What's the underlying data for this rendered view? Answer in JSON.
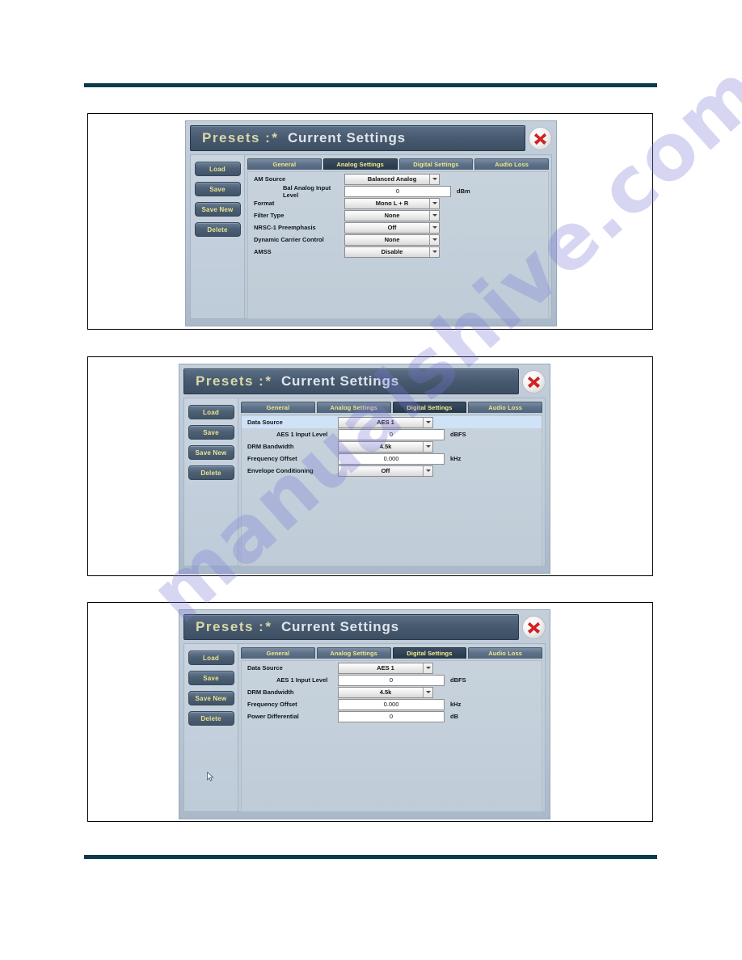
{
  "window": {
    "title_presets": "Presets :",
    "title_star": "*",
    "title_current": "Current Settings",
    "close_icon": "close-x-icon"
  },
  "sidebar": {
    "buttons": [
      {
        "label": "Load"
      },
      {
        "label": "Save"
      },
      {
        "label": "Save New"
      },
      {
        "label": "Delete"
      }
    ]
  },
  "tabs": [
    {
      "label": "General"
    },
    {
      "label": "Analog Settings"
    },
    {
      "label": "Digital Settings"
    },
    {
      "label": "Audio Loss"
    }
  ],
  "panels": [
    {
      "active_tab": "Analog Settings",
      "rows": [
        {
          "label": "AM Source",
          "type": "dropdown",
          "value": "Balanced Analog",
          "unit": "",
          "indent": false,
          "highlight": false
        },
        {
          "label": "Bal Analog Input Level",
          "type": "text",
          "value": "0",
          "unit": "dBm",
          "indent": true,
          "highlight": false
        },
        {
          "label": "Format",
          "type": "dropdown",
          "value": "Mono L + R",
          "unit": "",
          "indent": false,
          "highlight": false
        },
        {
          "label": "Filter Type",
          "type": "dropdown",
          "value": "None",
          "unit": "",
          "indent": false,
          "highlight": false
        },
        {
          "label": "NRSC-1 Preemphasis",
          "type": "dropdown",
          "value": "Off",
          "unit": "",
          "indent": false,
          "highlight": false
        },
        {
          "label": "Dynamic Carrier Control",
          "type": "dropdown",
          "value": "None",
          "unit": "",
          "indent": false,
          "highlight": false
        },
        {
          "label": "AMSS",
          "type": "dropdown",
          "value": "Disable",
          "unit": "",
          "indent": false,
          "highlight": false
        }
      ]
    },
    {
      "active_tab": "Digital Settings",
      "rows": [
        {
          "label": "Data Source",
          "type": "dropdown",
          "value": "AES 1",
          "unit": "",
          "indent": false,
          "highlight": true
        },
        {
          "label": "AES 1 Input Level",
          "type": "text",
          "value": "0",
          "unit": "dBFS",
          "indent": true,
          "highlight": false
        },
        {
          "label": "DRM Bandwidth",
          "type": "dropdown",
          "value": "4.5k",
          "unit": "",
          "indent": false,
          "highlight": false
        },
        {
          "label": "Frequency Offset",
          "type": "text",
          "value": "0.000",
          "unit": "kHz",
          "indent": false,
          "highlight": false
        },
        {
          "label": "Envelope Conditioning",
          "type": "dropdown",
          "value": "Off",
          "unit": "",
          "indent": false,
          "highlight": false
        }
      ]
    },
    {
      "active_tab": "Digital Settings",
      "rows": [
        {
          "label": "Data Source",
          "type": "dropdown",
          "value": "AES 1",
          "unit": "",
          "indent": false,
          "highlight": false
        },
        {
          "label": "AES 1 Input Level",
          "type": "text",
          "value": "0",
          "unit": "dBFS",
          "indent": true,
          "highlight": false
        },
        {
          "label": "DRM Bandwidth",
          "type": "dropdown",
          "value": "4.5k",
          "unit": "",
          "indent": false,
          "highlight": false
        },
        {
          "label": "Frequency Offset",
          "type": "text",
          "value": "0.000",
          "unit": "kHz",
          "indent": false,
          "highlight": false
        },
        {
          "label": "Power Differential",
          "type": "text",
          "value": "0",
          "unit": "dB",
          "indent": false,
          "highlight": false
        }
      ]
    }
  ],
  "watermark": {
    "text": "manualshive.com"
  },
  "colors": {
    "rule": "#0b3a4a",
    "title_accent": "#d8d8a8",
    "tab_text": "#f0e98e",
    "highlight_row": "#cfe2f6",
    "close_red": "#e02020"
  }
}
